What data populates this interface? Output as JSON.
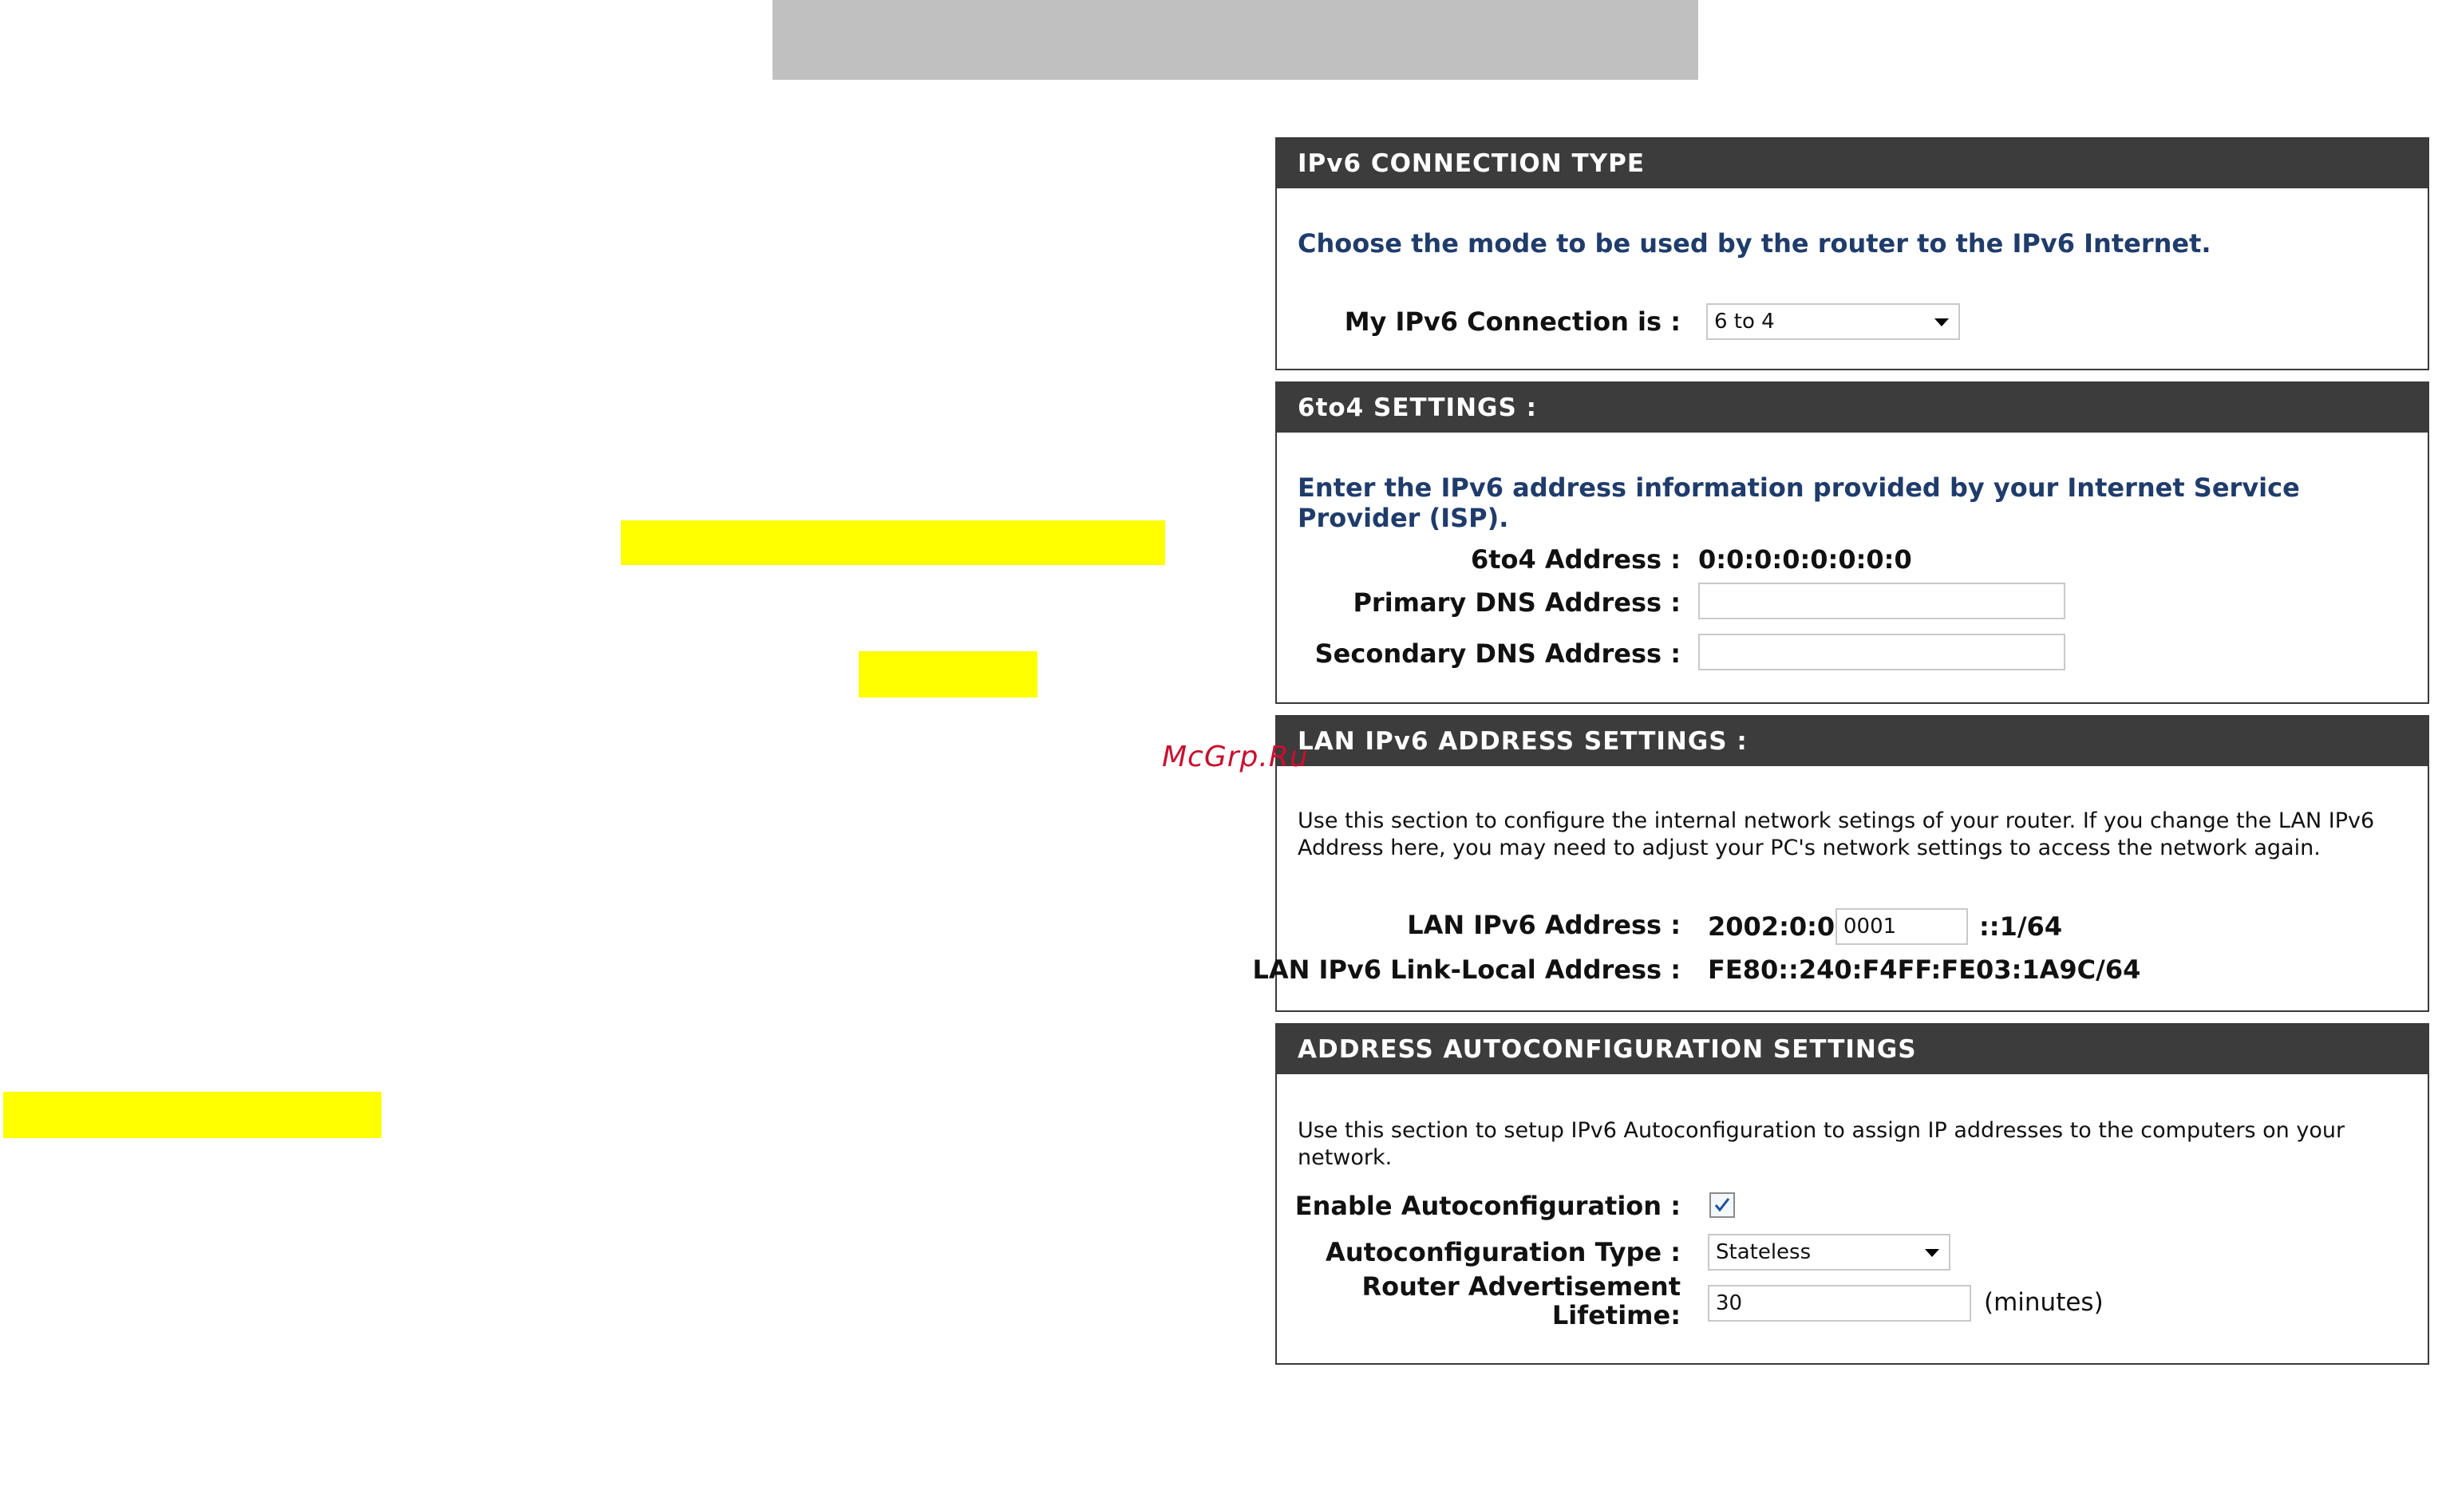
{
  "watermark": "McGrp.Ru",
  "ipv6_connection_type": {
    "header": "IPv6 CONNECTION TYPE",
    "intro": "Choose the mode to be used by the router to the IPv6 Internet.",
    "connection_label": "My IPv6 Connection is :",
    "connection_value": "6 to 4"
  },
  "sixto4_settings": {
    "header": "6to4 SETTINGS :",
    "intro": "Enter the IPv6 address information provided by your Internet Service Provider (ISP).",
    "address_label": "6to4 Address :",
    "address_value": "0:0:0:0:0:0:0:0",
    "primary_dns_label": "Primary DNS Address :",
    "primary_dns_value": "",
    "secondary_dns_label": "Secondary DNS Address :",
    "secondary_dns_value": ""
  },
  "lan_ipv6_settings": {
    "header": "LAN IPv6 ADDRESS SETTINGS :",
    "intro": "Use this section to configure the internal network setings of your router. If you change the LAN IPv6 Address here, you may need to adjust your PC's network settings to access the network again.",
    "lan_address_label": "LAN IPv6 Address :",
    "lan_address_prefix": "2002:0:0:",
    "lan_address_input": "0001",
    "lan_address_suffix": "::1/64",
    "link_local_label": "LAN IPv6 Link-Local Address :",
    "link_local_value": "FE80::240:F4FF:FE03:1A9C/64"
  },
  "autoconfig_settings": {
    "header": "ADDRESS AUTOCONFIGURATION SETTINGS",
    "intro": "Use this section to setup IPv6 Autoconfiguration to assign IP addresses to the computers on your network.",
    "enable_label": "Enable Autoconfiguration :",
    "enable_checked": true,
    "type_label": "Autoconfiguration Type :",
    "type_value": "Stateless",
    "lifetime_label": "Router Advertisement Lifetime:",
    "lifetime_value": "30",
    "lifetime_unit": "(minutes)"
  }
}
